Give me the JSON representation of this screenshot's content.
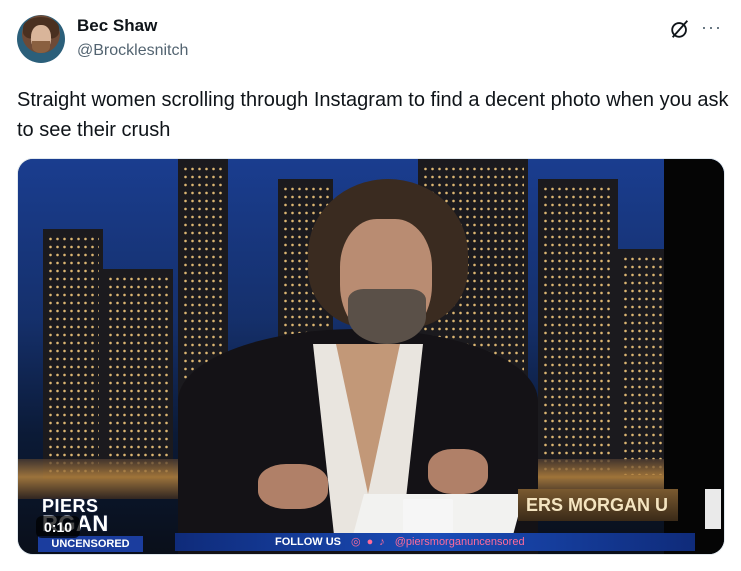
{
  "author": {
    "name": "Bec Shaw",
    "handle": "@Brocklesnitch"
  },
  "header_icons": {
    "grok": "grok-icon",
    "more": "more-icon",
    "more_glyph": "···"
  },
  "tweet": {
    "text": "Straight women scrolling through Instagram to find a decent photo when you ask to see their crush"
  },
  "media": {
    "type": "video",
    "duration": "0:10",
    "logo": {
      "line1": "PIERS",
      "line2": "RGAN",
      "line3": "UNCENSORED"
    },
    "banner_right": "ERS MORGAN U",
    "ticker": {
      "follow": "FOLLOW US",
      "social_handle": "@piersmorganuncensored"
    }
  }
}
